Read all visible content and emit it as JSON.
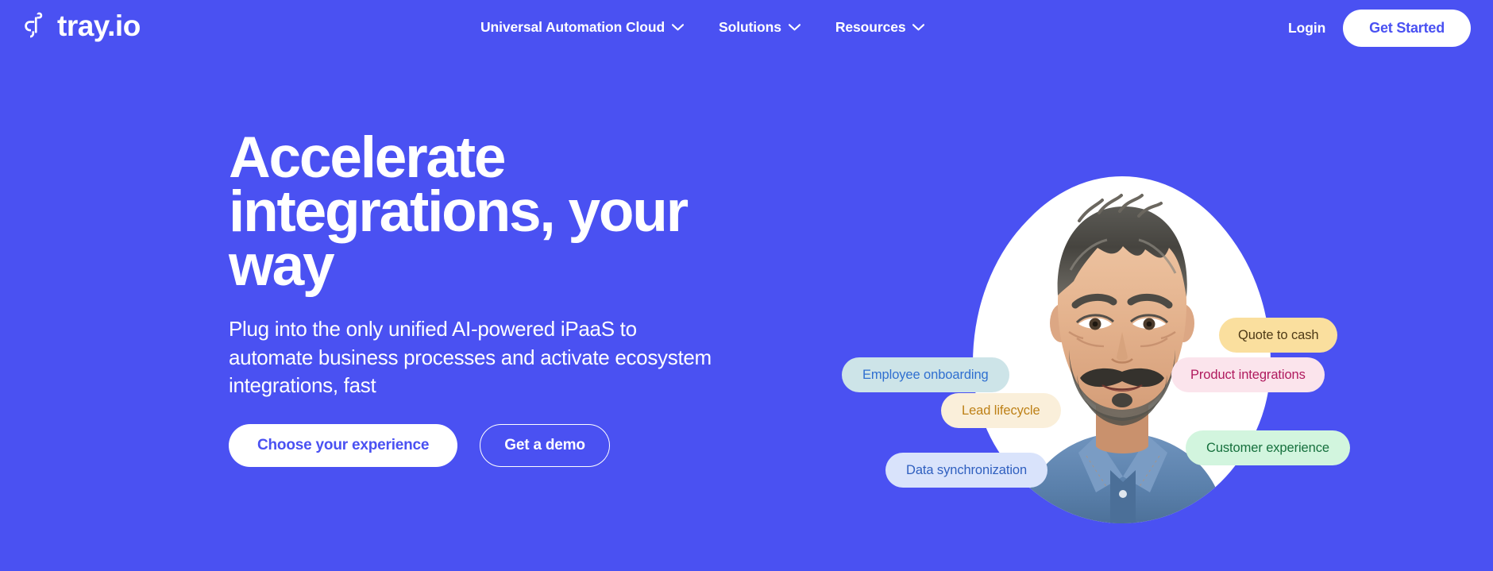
{
  "theme": {
    "background": "#4a51f2",
    "accent_on_white": "#4a51f2",
    "text_on_blue": "#ffffff"
  },
  "header": {
    "logo_text": "tray.io",
    "logo_icon": "tray-logo-mark",
    "nav": [
      {
        "label": "Universal Automation Cloud",
        "has_dropdown": true,
        "icon": "chevron-down-icon"
      },
      {
        "label": "Solutions",
        "has_dropdown": true,
        "icon": "chevron-down-icon"
      },
      {
        "label": "Resources",
        "has_dropdown": true,
        "icon": "chevron-down-icon"
      }
    ],
    "login_label": "Login",
    "get_started_label": "Get Started"
  },
  "hero": {
    "title": "Accelerate integrations, your way",
    "subtitle": "Plug into the only unified AI-powered iPaaS to automate business processes and activate ecosystem integrations, fast",
    "primary_cta": "Choose your experience",
    "secondary_cta": "Get a demo"
  },
  "visual": {
    "portrait_alt": "smiling-man-portrait",
    "pills": [
      {
        "label": "Employee onboarding",
        "bg": "#cde4e8",
        "fg": "#2f6fd0"
      },
      {
        "label": "Quote to cash",
        "bg": "#fadf9e",
        "fg": "#4e3a17"
      },
      {
        "label": "Product integrations",
        "bg": "#fbe4ec",
        "fg": "#b01a5e"
      },
      {
        "label": "Lead lifecycle",
        "bg": "#faefda",
        "fg": "#bd8016"
      },
      {
        "label": "Data synchronization",
        "bg": "#d9e3fb",
        "fg": "#2f5fbf"
      },
      {
        "label": "Customer experience",
        "bg": "#d2f5de",
        "fg": "#16703d"
      }
    ]
  }
}
